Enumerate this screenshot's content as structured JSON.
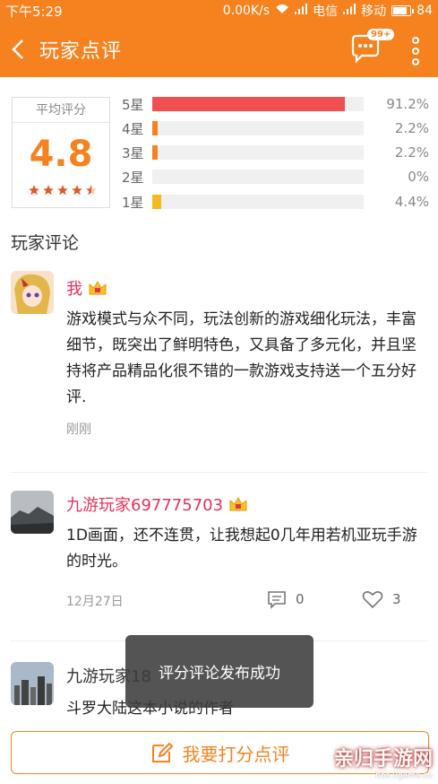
{
  "status_bar": {
    "time": "下午5:29",
    "network_speed": "0.00K/s",
    "carrier1": "电信",
    "carrier2": "移动",
    "battery": "84"
  },
  "header": {
    "title": "玩家点评",
    "badge": "99+"
  },
  "rating": {
    "label": "平均评分",
    "score": "4.8",
    "stars": 4.5,
    "distribution": [
      {
        "label": "5星",
        "percent_text": "91.2%",
        "value": 91.2,
        "color": "#f05050"
      },
      {
        "label": "4星",
        "percent_text": "2.2%",
        "value": 2.2,
        "color": "#f5821f"
      },
      {
        "label": "3星",
        "percent_text": "2.2%",
        "value": 2.2,
        "color": "#f5821f"
      },
      {
        "label": "2星",
        "percent_text": "0%",
        "value": 0,
        "color": "#f5821f"
      },
      {
        "label": "1星",
        "percent_text": "4.4%",
        "value": 4.4,
        "color": "#f5b81f"
      }
    ]
  },
  "section_title": "玩家评论",
  "comments": [
    {
      "name": "我",
      "text": "游戏模式与众不同，玩法创新的游戏细化玩法，丰富细节，既突出了鲜明特色，又具备了多元化，并且坚持将产品精品化很不错的一款游戏支持送一个五分好评.",
      "date": "刚刚"
    },
    {
      "name": "九游玩家697775703",
      "text": "1D画面，还不连贯，让我想起0几年用若机亚玩手游的时光。",
      "date": "12月27日",
      "replies": "0",
      "likes": "3"
    },
    {
      "name": "九游玩家18",
      "text": "斗罗大陆这本小说的作者"
    }
  ],
  "toast": "评分评论发布成功",
  "bottom": {
    "button_label": "我要打分点评"
  },
  "watermark": {
    "text": "亲归手游网",
    "url": "bbs.9game.cn"
  },
  "colors": {
    "brand": "#f5821f",
    "username": "#e0325a"
  }
}
